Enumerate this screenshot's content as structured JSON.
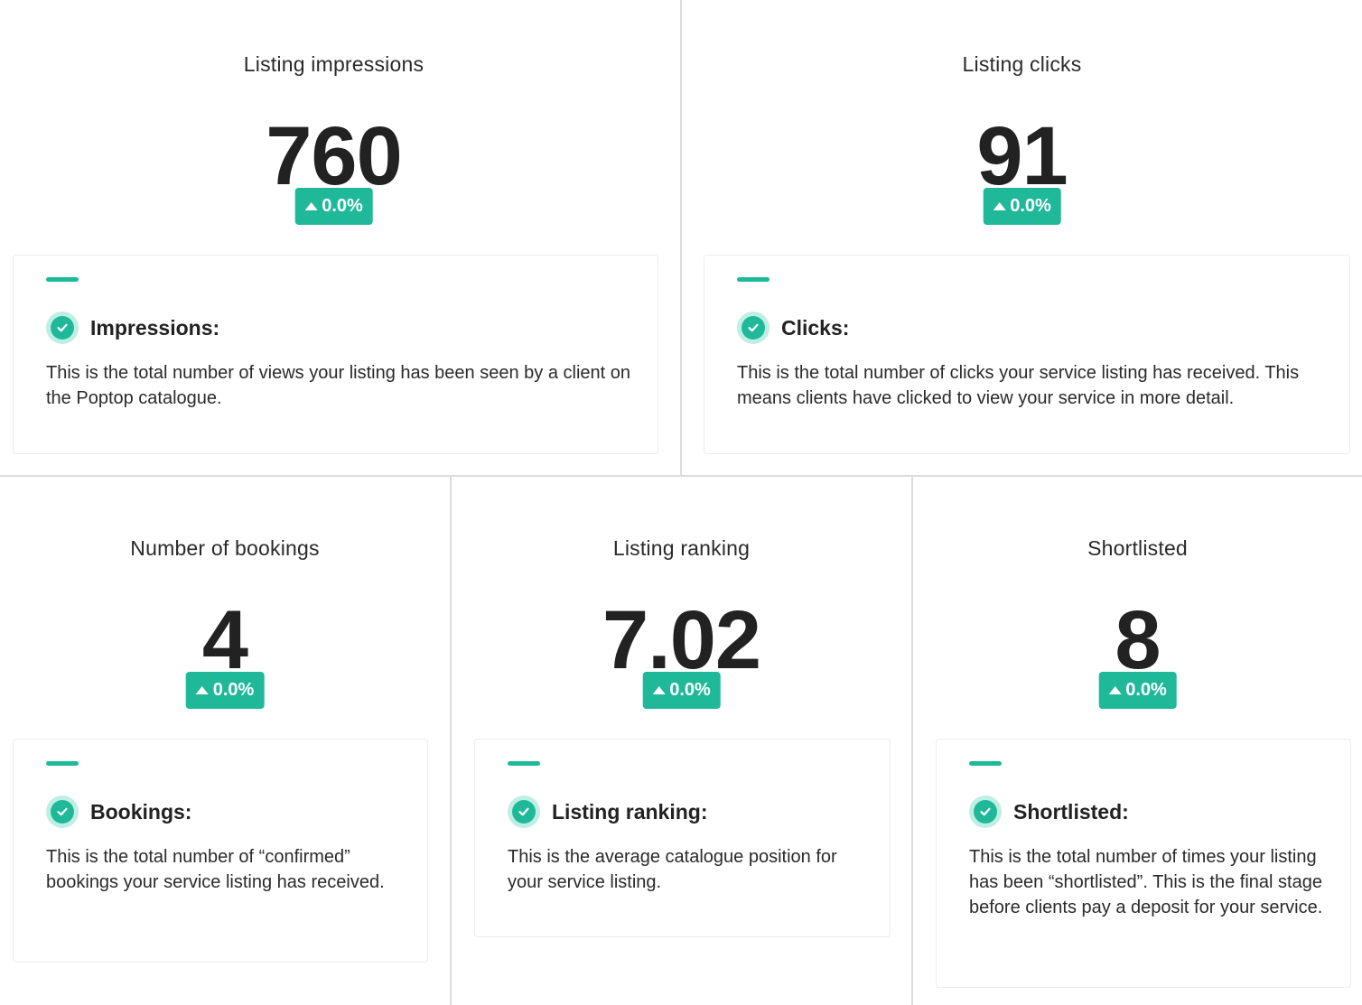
{
  "accent_color": "#1fb99a",
  "badge_icon": "triangle-up-icon",
  "info_icon": "check-circle-icon",
  "stats": [
    {
      "title": "Listing impressions",
      "value": "760",
      "change": "0.0%",
      "info_heading": "Impressions:",
      "info_text": "This is the total number of views your listing has been seen by a client on the Poptop catalogue."
    },
    {
      "title": "Listing clicks",
      "value": "91",
      "change": "0.0%",
      "info_heading": "Clicks:",
      "info_text": "This is the total number of clicks your service listing has received. This means clients have clicked to view your service in more detail."
    },
    {
      "title": "Number of bookings",
      "value": "4",
      "change": "0.0%",
      "info_heading": "Bookings:",
      "info_text": "This is the total number of “confirmed” bookings your service listing has received."
    },
    {
      "title": "Listing ranking",
      "value": "7.02",
      "change": "0.0%",
      "info_heading": "Listing ranking:",
      "info_text": "This is the average catalogue position for your service listing."
    },
    {
      "title": "Shortlisted",
      "value": "8",
      "change": "0.0%",
      "info_heading": "Shortlisted:",
      "info_text": "This is the total number of times your listing has been “shortlisted”. This is the final stage before clients pay a deposit for your service."
    }
  ]
}
